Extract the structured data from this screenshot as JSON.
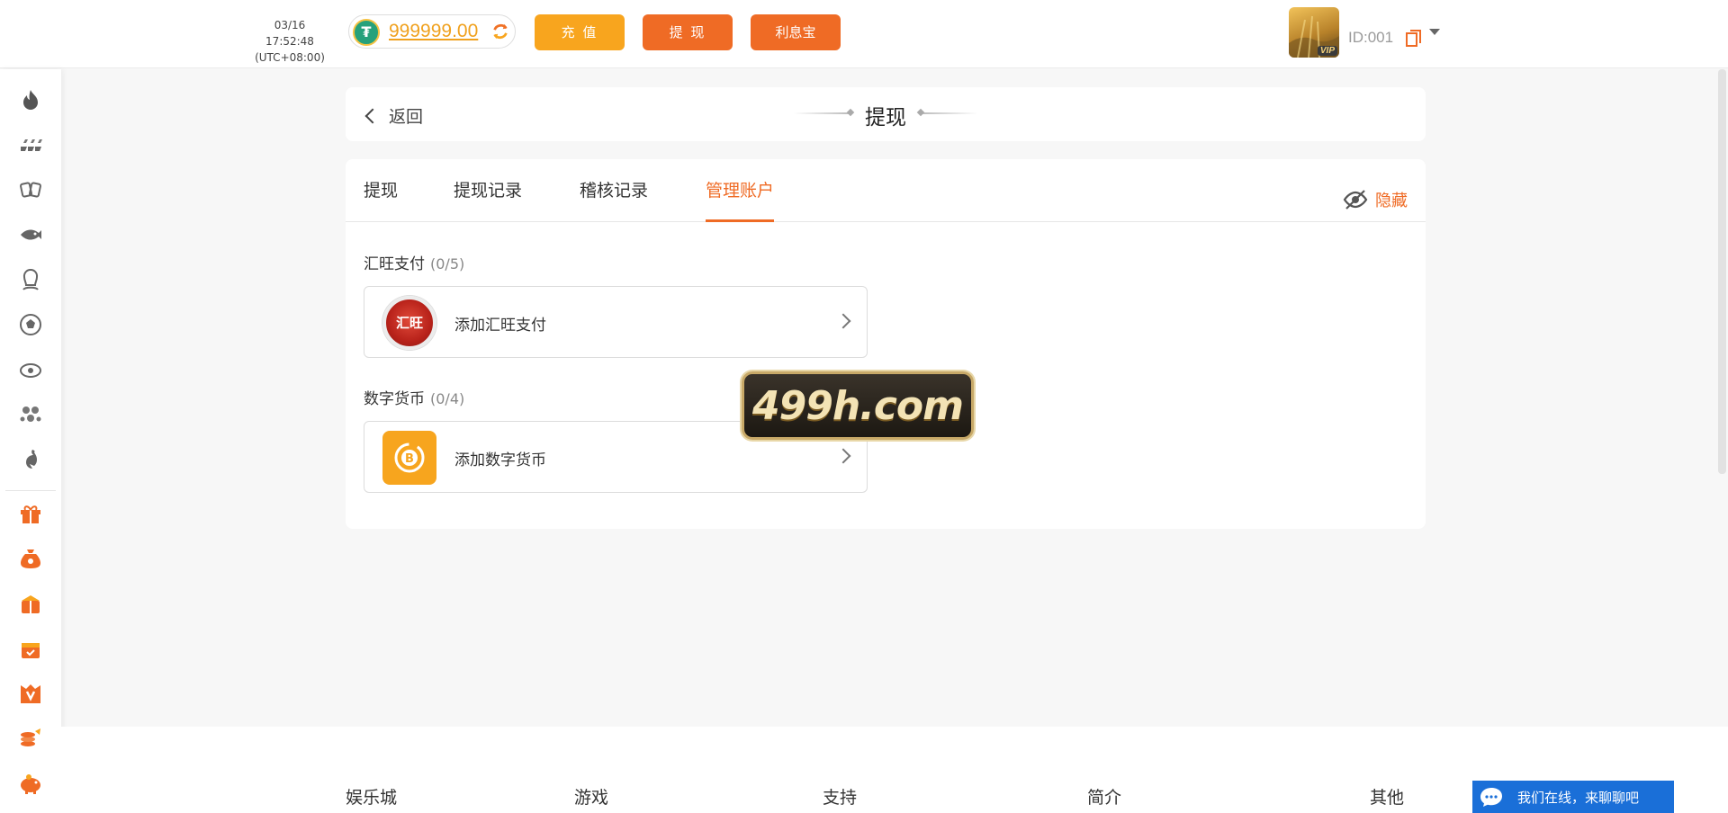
{
  "header": {
    "time": "03/16 17:52:48",
    "timezone": "(UTC+08:00)",
    "balance": "999999.00",
    "currency_icon": "usdt-icon",
    "buttons": {
      "deposit": "充 值",
      "withdraw": "提 现",
      "interest": "利息宝"
    },
    "vip_badge": "VIP",
    "user_id": "ID:001"
  },
  "sidebar": {
    "items": [
      "hot-icon",
      "slots-icon",
      "cards-icon",
      "fishing-icon",
      "live-dealer-icon",
      "sports-icon",
      "esports-icon",
      "lottery-icon",
      "cockfight-icon",
      "gift-icon",
      "money-bag-icon",
      "promo-icon",
      "reward-box-icon",
      "vip-icon",
      "rebate-icon",
      "piggy-bank-icon"
    ]
  },
  "page": {
    "back_label": "返回",
    "title": "提现"
  },
  "tabs": [
    {
      "label": "提现"
    },
    {
      "label": "提现记录"
    },
    {
      "label": "稽核记录"
    },
    {
      "label": "管理账户"
    }
  ],
  "active_tab": "管理账户",
  "hide_label": "隐藏",
  "sections": [
    {
      "title": "汇旺支付",
      "count": "(0/5)",
      "logo_text": "汇旺",
      "add_label": "添加汇旺支付"
    },
    {
      "title": "数字货币",
      "count": "(0/4)",
      "add_label": "添加数字货币"
    }
  ],
  "watermark": "499h.com",
  "footer": {
    "columns": [
      "娱乐城",
      "游戏",
      "支持",
      "简介",
      "其他"
    ]
  },
  "chat": {
    "label": "我们在线，来聊聊吧"
  },
  "colors": {
    "accent": "#ef6b25",
    "deposit": "#f8a51e",
    "chat": "#1a6fd8"
  }
}
